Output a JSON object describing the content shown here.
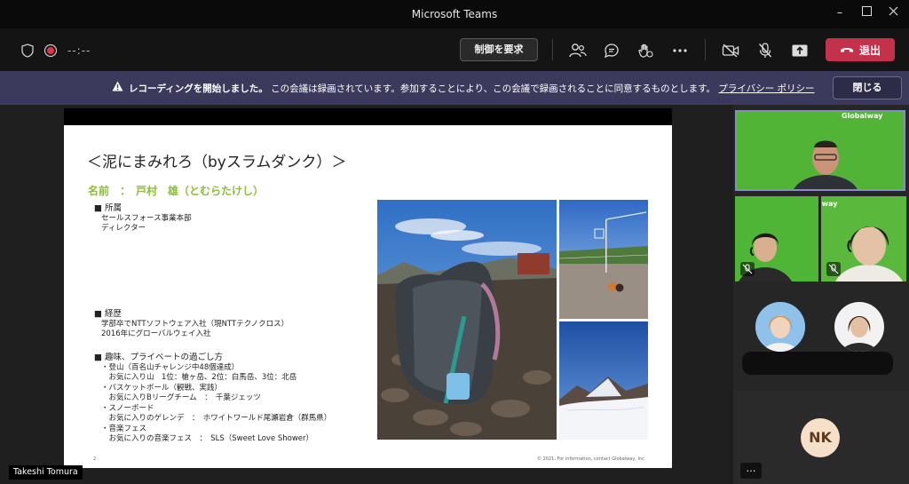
{
  "window": {
    "title": "Microsoft Teams"
  },
  "toolbar": {
    "timer": "--:--",
    "request_control_label": "制御を要求",
    "leave_label": "退出"
  },
  "banner": {
    "bold_text": "レコーディングを開始しました。",
    "message": "この会議は録画されています。参加することにより、この会議で録画されることに同意するものとします。",
    "link_text": "プライバシー ポリシー",
    "close_label": "閉じる"
  },
  "slide": {
    "title": "＜泥にまみれろ（byスラムダンク）＞",
    "name_line": "名前　：　戸村　雄（とむらたけし）",
    "section1": {
      "heading": "■ 所属",
      "lines": [
        "セールスフォース事業本部",
        "ディレクター"
      ]
    },
    "section2": {
      "heading": "■ 経歴",
      "lines": [
        "学部卒でNTTソフトウェア入社（現NTTテクノクロス）",
        "2016年にグローバルウェイ入社"
      ]
    },
    "section3": {
      "heading": "■ 趣味、プライベートの過ごし方",
      "lines": [
        "・登山（百名山チャレンジ中48個達成）",
        "　お気に入り山　1位：槍ヶ岳、2位：白馬岳、3位：北岳",
        "・バスケットボール（観戦、実践）",
        "　お気に入りBリーグチーム　：　千葉ジェッツ",
        "・スノーボード",
        "　お気に入りのゲレンデ　：　ホワイトワールド尾瀬岩倉（群馬県）",
        "・音楽フェス",
        "　お気に入りの音楽フェス　：　SLS（Sweet Love Shower）"
      ]
    },
    "page_number": "2",
    "copyright": "© 2021. For information, contact Globalway, Inc"
  },
  "presenter": {
    "name": "Takeshi Tomura"
  },
  "participants": {
    "brand": "Globalway",
    "initials": "NK",
    "more_label": "…"
  }
}
